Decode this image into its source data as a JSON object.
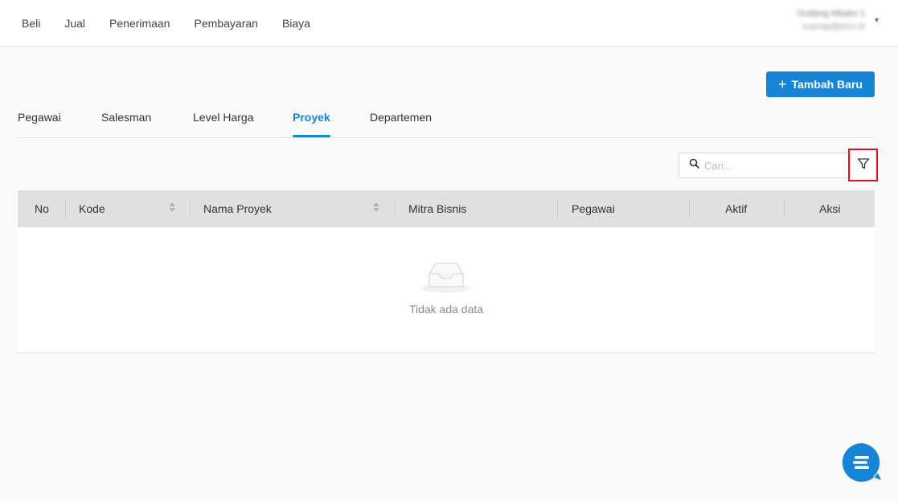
{
  "topnav": {
    "items": [
      {
        "label": "Beli"
      },
      {
        "label": "Jual"
      },
      {
        "label": "Penerimaan"
      },
      {
        "label": "Pembayaran"
      },
      {
        "label": "Biaya"
      }
    ]
  },
  "user": {
    "name": "Gudang Mbako 1",
    "sub": "supriagi@jitero.id"
  },
  "actions": {
    "add_label": "Tambah Baru"
  },
  "tabs": {
    "items": [
      {
        "label": "Pegawai"
      },
      {
        "label": "Salesman"
      },
      {
        "label": "Level Harga"
      },
      {
        "label": "Proyek",
        "active": true
      },
      {
        "label": "Departemen"
      }
    ]
  },
  "search": {
    "placeholder": "Cari..."
  },
  "table": {
    "columns": [
      {
        "label": "No"
      },
      {
        "label": "Kode",
        "sortable": true
      },
      {
        "label": "Nama Proyek",
        "sortable": true
      },
      {
        "label": "Mitra Bisnis"
      },
      {
        "label": "Pegawai"
      },
      {
        "label": "Aktif"
      },
      {
        "label": "Aksi"
      }
    ],
    "rows": [],
    "empty_text": "Tidak ada data"
  },
  "colors": {
    "accent": "#1784d6",
    "highlight": "#e0141e",
    "header_bg": "#e0e0e0"
  },
  "icons": {
    "add": "plus-icon",
    "search": "search-icon",
    "filter": "filter-icon",
    "empty": "empty-inbox-icon",
    "chat": "chat-icon"
  }
}
